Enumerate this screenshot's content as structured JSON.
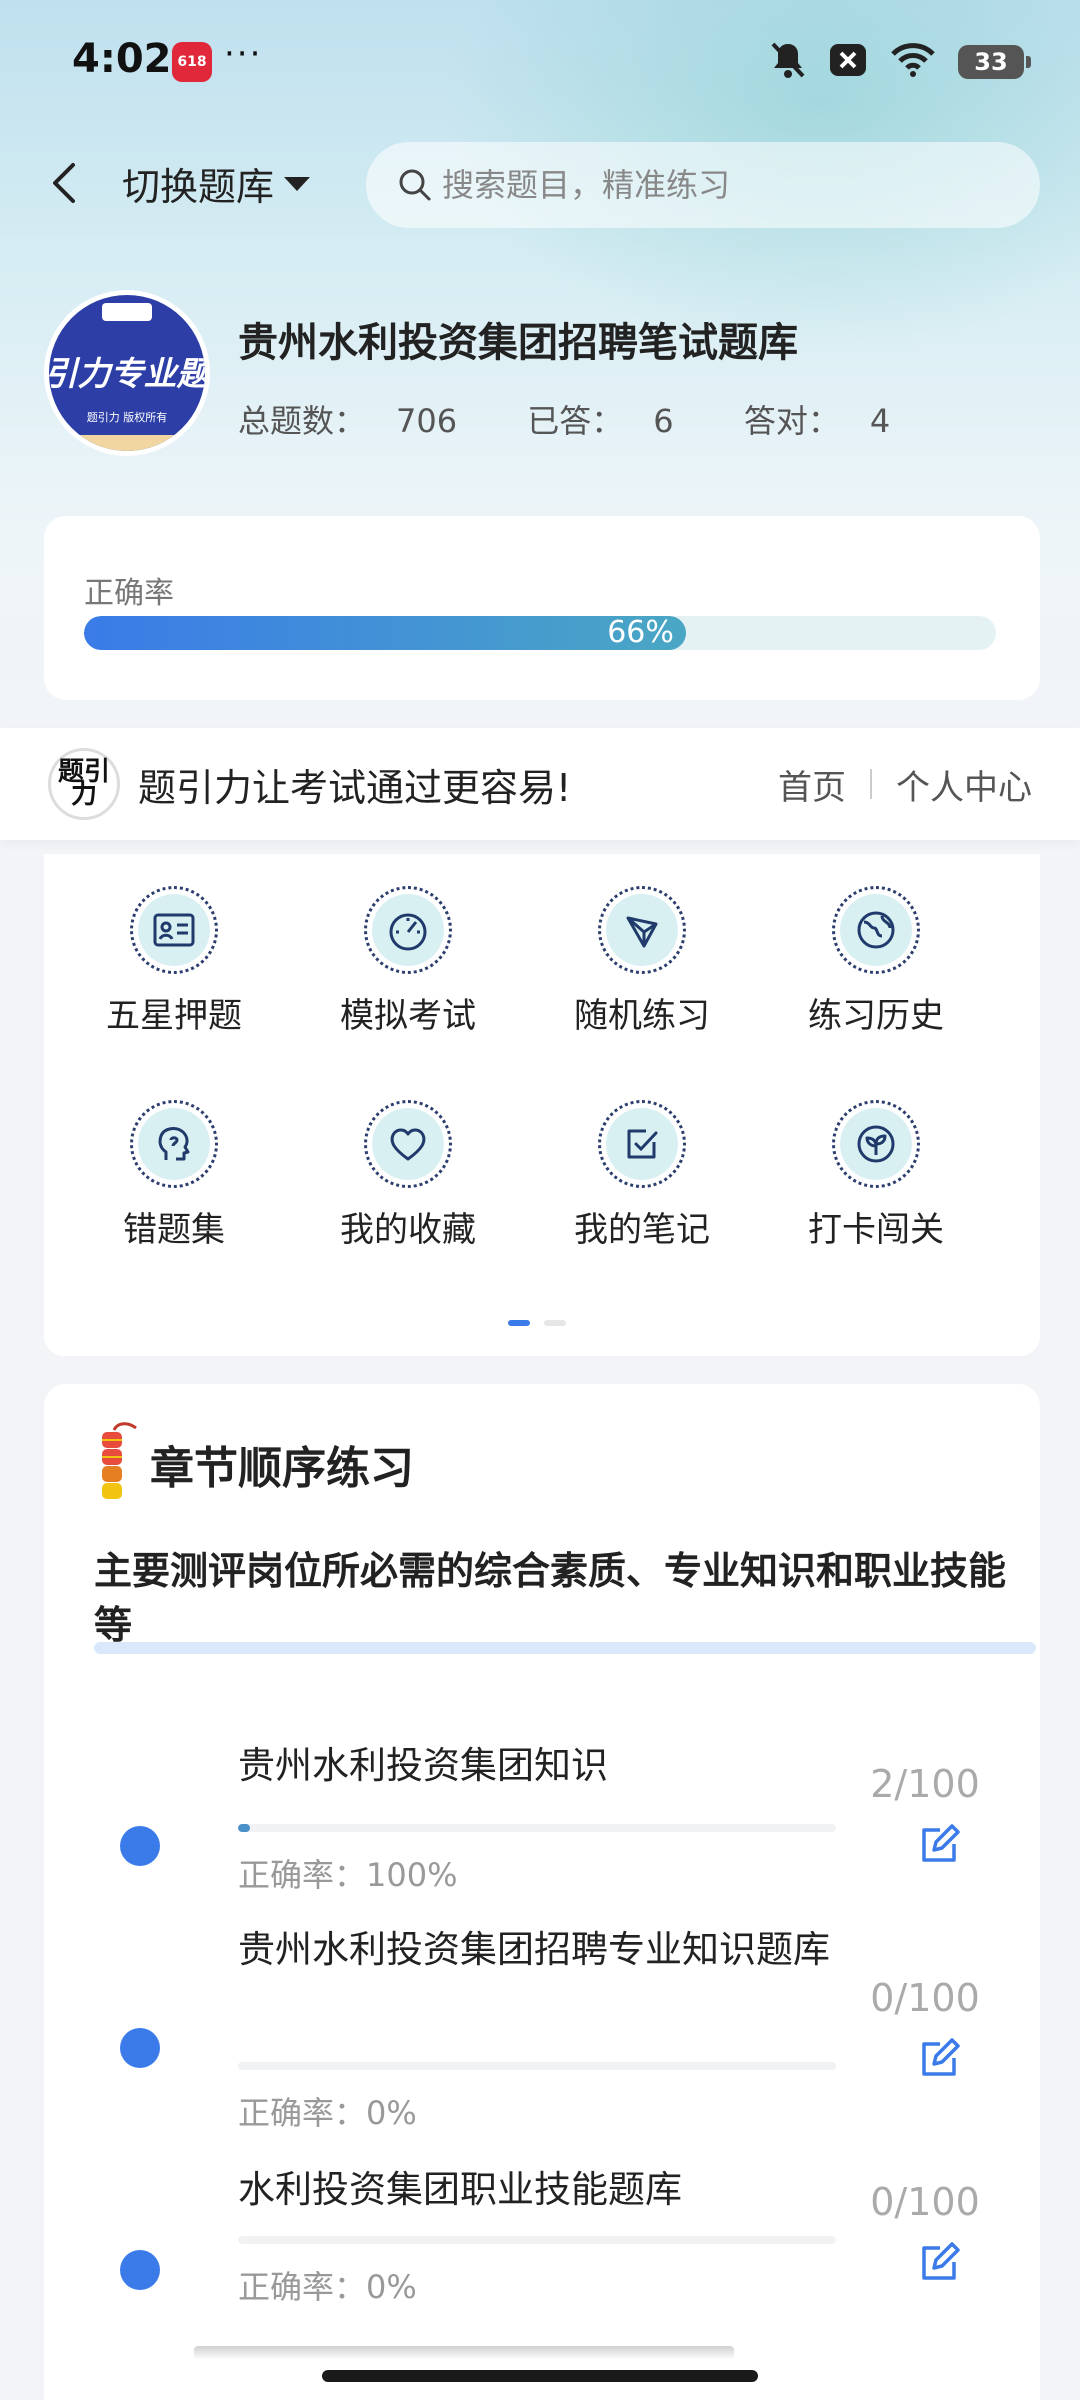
{
  "status_bar": {
    "time": "4:02",
    "app_badge": "618",
    "overflow": "···",
    "battery": "33"
  },
  "header": {
    "switch_label": "切换题库",
    "search_placeholder": "搜索题目，精准练习"
  },
  "bank": {
    "logo_text": "引力专业题",
    "logo_subtext": "题引力 版权所有",
    "title": "贵州水利投资集团招聘笔试题库",
    "stats": {
      "total_label": "总题数：",
      "total": "706",
      "answered_label": "已答：",
      "answered": "6",
      "correct_label": "答对：",
      "correct": "4"
    }
  },
  "accuracy": {
    "label": "正确率",
    "value_text": "66%",
    "fraction": 0.66
  },
  "brand_bar": {
    "logo_text": "题引力",
    "slogan": "题引力让考试通过更容易!",
    "links": [
      "首页",
      "个人中心"
    ]
  },
  "features": [
    {
      "label": "五星押题",
      "icon": "id-card-icon"
    },
    {
      "label": "模拟考试",
      "icon": "speedometer-icon"
    },
    {
      "label": "随机练习",
      "icon": "network-icon"
    },
    {
      "label": "练习历史",
      "icon": "globe-icon"
    },
    {
      "label": "错题集",
      "icon": "head-icon"
    },
    {
      "label": "我的收藏",
      "icon": "heart-icon"
    },
    {
      "label": "我的笔记",
      "icon": "checklist-icon"
    },
    {
      "label": "打卡闯关",
      "icon": "leaf-icon"
    }
  ],
  "pager": {
    "pages": 2,
    "active": 0
  },
  "chapter": {
    "title": "章节顺序练习",
    "description": "主要测评岗位所必需的综合素质、专业知识和职业技能等",
    "items": [
      {
        "title": "贵州水利投资集团知识",
        "progress_text": "2/100",
        "progress": 0.02,
        "accuracy_label": "正确率：",
        "accuracy": "100%"
      },
      {
        "title": "贵州水利投资集团招聘专业知识题库",
        "progress_text": "0/100",
        "progress": 0,
        "accuracy_label": "正确率：",
        "accuracy": "0%"
      },
      {
        "title": "水利投资集团职业技能题库",
        "progress_text": "0/100",
        "progress": 0,
        "accuracy_label": "正确率：",
        "accuracy": "0%"
      }
    ]
  },
  "colors": {
    "accent": "#3b7be9",
    "progress_track": "#e4f2f4",
    "icon_bg": "#d9f0f3"
  }
}
